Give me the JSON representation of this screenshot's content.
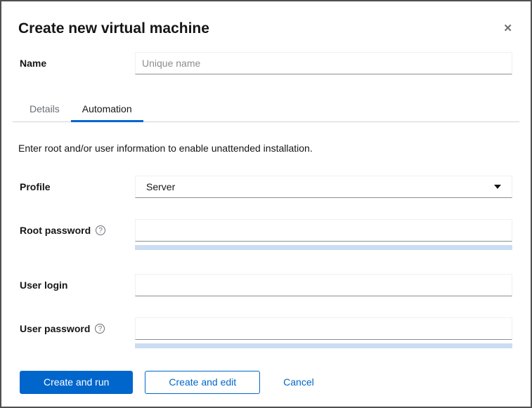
{
  "dialog": {
    "title": "Create new virtual machine"
  },
  "icons": {
    "close_glyph": "✕",
    "help_glyph": "?"
  },
  "form": {
    "name": {
      "label": "Name",
      "placeholder": "Unique name",
      "value": ""
    },
    "profile": {
      "label": "Profile",
      "value": "Server"
    },
    "root_password": {
      "label": "Root password",
      "value": ""
    },
    "user_login": {
      "label": "User login",
      "value": ""
    },
    "user_password": {
      "label": "User password",
      "value": ""
    }
  },
  "tabs": [
    {
      "label": "Details",
      "active": false
    },
    {
      "label": "Automation",
      "active": true
    }
  ],
  "description": "Enter root and/or user information to enable unattended installation.",
  "footer": {
    "create_and_run": "Create and run",
    "create_and_edit": "Create and edit",
    "cancel": "Cancel"
  },
  "colors": {
    "primary_blue": "#0066cc",
    "active_tab_underline": "#0066cc",
    "password_strength_bar": "#cbddf2",
    "input_bottom_border": "#8a8d90",
    "muted_text": "#6a6e73",
    "window_border": "#4f4f4f"
  }
}
